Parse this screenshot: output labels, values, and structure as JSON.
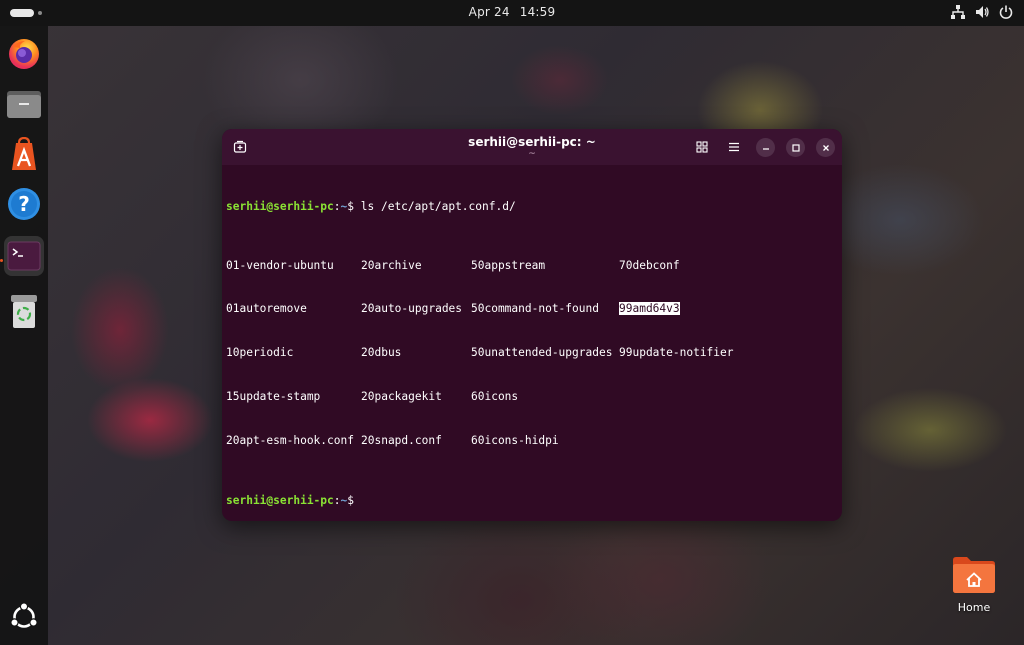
{
  "topbar": {
    "date": "Apr 24",
    "time": "14:59"
  },
  "dock": {
    "items": [
      {
        "name": "Firefox"
      },
      {
        "name": "Files"
      },
      {
        "name": "App Center"
      },
      {
        "name": "Help"
      },
      {
        "name": "Terminal",
        "active": true
      },
      {
        "name": "Trash"
      }
    ],
    "show_apps": "Show Apps"
  },
  "terminal": {
    "title": "serhii@serhii-pc: ~",
    "subtitle": "~",
    "prompt_user": "serhii@serhii-pc",
    "prompt_sep": ":",
    "prompt_path": "~",
    "prompt_symbol": "$",
    "command": " ls /etc/apt/apt.conf.d/",
    "rows": [
      [
        "01-vendor-ubuntu",
        "20archive",
        "50appstream",
        "70debconf"
      ],
      [
        "01autoremove",
        "20auto-upgrades",
        "50command-not-found",
        "99amd64v3"
      ],
      [
        "10periodic",
        "20dbus",
        "50unattended-upgrades",
        "99update-notifier"
      ],
      [
        "15update-stamp",
        "20packagekit",
        "60icons",
        ""
      ],
      [
        "20apt-esm-hook.conf",
        "20snapd.conf",
        "60icons-hidpi",
        ""
      ]
    ],
    "highlighted_file": "99amd64v3",
    "colors": {
      "background": "#300a24",
      "prompt_user": "#8ae234",
      "prompt_path": "#729fcf"
    }
  },
  "desktop": {
    "home_label": "Home"
  },
  "accent_color": "#e95420"
}
